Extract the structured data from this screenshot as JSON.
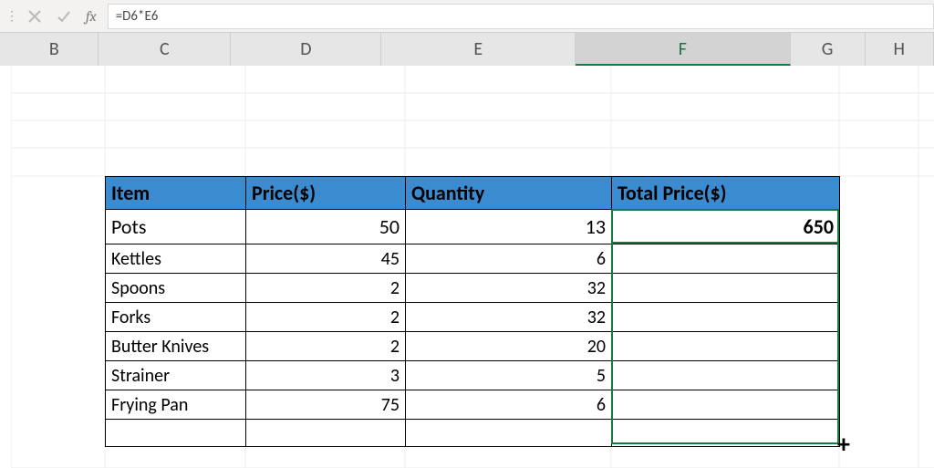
{
  "formula_bar": {
    "fx_label": "fx",
    "formula": "=D6*E6"
  },
  "columns": [
    "B",
    "C",
    "D",
    "E",
    "F",
    "G",
    "H"
  ],
  "selected_column": "F",
  "headers": {
    "item": "Item",
    "price": "Price($)",
    "qty": "Quantity",
    "total": "Total Price($)"
  },
  "rows": [
    {
      "item": "Pots",
      "price": "50",
      "qty": "13",
      "total": "650"
    },
    {
      "item": "Kettles",
      "price": "45",
      "qty": "6",
      "total": ""
    },
    {
      "item": "Spoons",
      "price": "2",
      "qty": "32",
      "total": ""
    },
    {
      "item": "Forks",
      "price": "2",
      "qty": "32",
      "total": ""
    },
    {
      "item": "Butter Knives",
      "price": "2",
      "qty": "20",
      "total": ""
    },
    {
      "item": "Strainer",
      "price": "3",
      "qty": "5",
      "total": ""
    },
    {
      "item": "Frying Pan",
      "price": "75",
      "qty": "6",
      "total": ""
    }
  ],
  "cursor_glyph": "+",
  "colors": {
    "header_bg": "#3b8bd0",
    "selection_green": "#107c41"
  }
}
